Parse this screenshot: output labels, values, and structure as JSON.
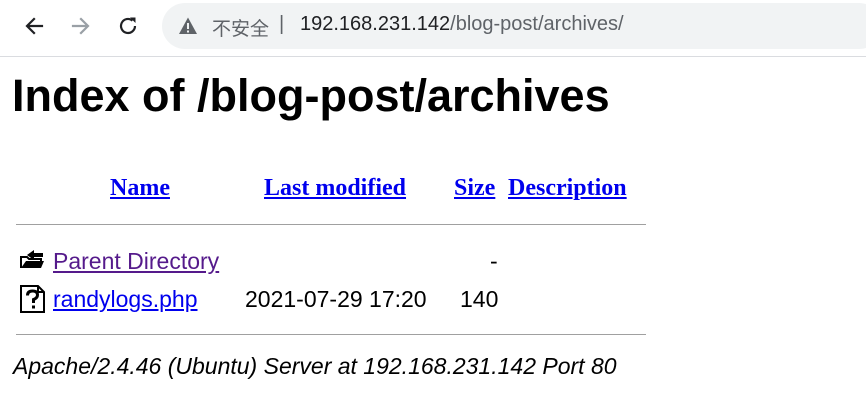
{
  "browser": {
    "security_label": "不安全",
    "separator": "|",
    "url_host": "192.168.231.142",
    "url_path": "/blog-post/archives/"
  },
  "page": {
    "title": "Index of /blog-post/archives",
    "columns": {
      "name": "Name",
      "last_modified": "Last modified",
      "size": "Size",
      "description": "Description"
    },
    "rows": [
      {
        "name": "Parent Directory",
        "last_modified": "",
        "size": "-",
        "icon": "back-folder-icon"
      },
      {
        "name": "randylogs.php",
        "last_modified": "2021-07-29 17:20",
        "size": "140",
        "icon": "unknown-file-icon"
      }
    ],
    "footer": "Apache/2.4.46 (Ubuntu) Server at 192.168.231.142 Port 80"
  }
}
